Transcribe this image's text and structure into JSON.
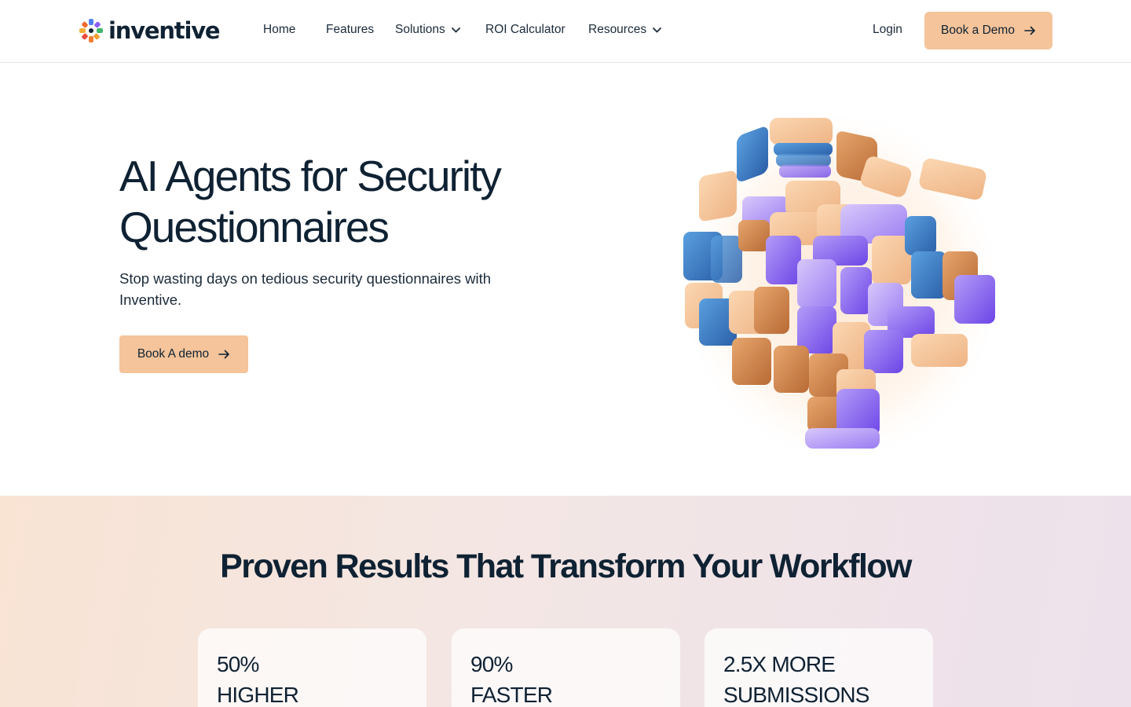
{
  "brand": {
    "name": "inventive"
  },
  "nav": {
    "items": [
      {
        "label": "Home",
        "has_dropdown": false
      },
      {
        "label": "Features",
        "has_dropdown": false
      },
      {
        "label": "Solutions",
        "has_dropdown": true
      },
      {
        "label": "ROI Calculator",
        "has_dropdown": false
      },
      {
        "label": "Resources",
        "has_dropdown": true
      }
    ],
    "login_label": "Login",
    "cta_label": "Book a Demo"
  },
  "hero": {
    "title": "AI Agents for Security Questionnaires",
    "subtitle": "Stop wasting days on tedious security questionnaires with Inventive.",
    "cta_label": "Book A demo",
    "illustration_icon": "tile-cube-illustration"
  },
  "results": {
    "title": "Proven Results That Transform Your Workflow",
    "cards": [
      {
        "line1": "50%",
        "line2": "HIGHER"
      },
      {
        "line1": "90%",
        "line2": "FASTER"
      },
      {
        "line1": "2.5X MORE",
        "line2": "SUBMISSIONS"
      }
    ]
  },
  "colors": {
    "accent": "#f5c49a",
    "text_dark": "#0f2233",
    "tile_peach": "#f2b98a",
    "tile_orange": "#d98e52",
    "tile_blue": "#3b7fc4",
    "tile_purple": "#8b5cf6"
  },
  "icons": {
    "arrow": "arrow-right-icon",
    "dropdown": "chevron-down-icon"
  }
}
